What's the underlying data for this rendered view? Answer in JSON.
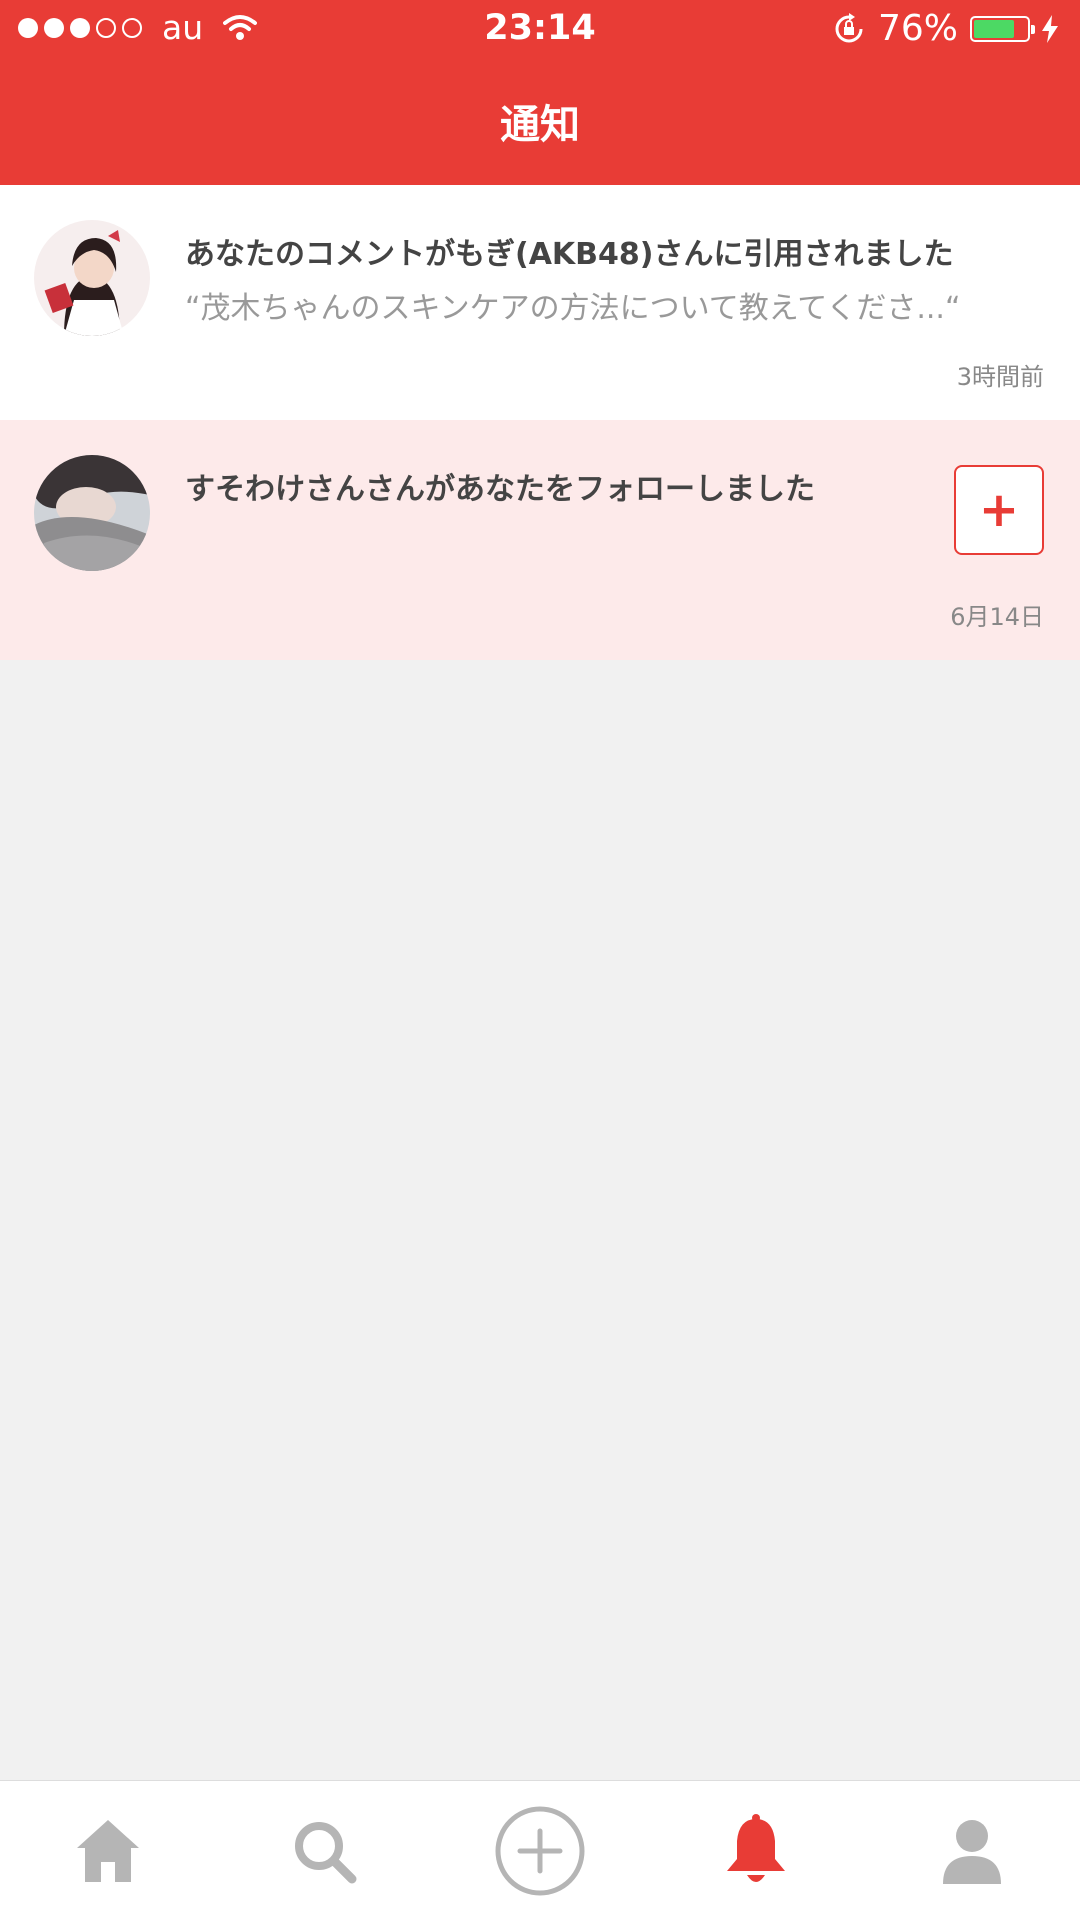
{
  "status_bar": {
    "carrier": "au",
    "time": "23:14",
    "battery": "76%",
    "battery_level": 0.76
  },
  "header": {
    "title": "通知"
  },
  "notifications": [
    {
      "title": "あなたのコメントがもぎ(AKB48)さんに引用されました",
      "subtitle": "“茂木ちゃんのスキンケアの方法について教えてくださ...“",
      "time": "3時間前"
    },
    {
      "title": "すそわけさんさんがあなたをフォローしました",
      "time": "6月14日",
      "follow_label": "+"
    }
  ],
  "tabs": [
    {
      "icon": "home-icon"
    },
    {
      "icon": "search-icon"
    },
    {
      "icon": "add-circle-icon"
    },
    {
      "icon": "bell-icon",
      "active": true
    },
    {
      "icon": "profile-icon"
    }
  ],
  "colors": {
    "accent": "#e83c36",
    "unread_bg": "#fdeaea",
    "inactive_icon": "#b5b5b5"
  }
}
